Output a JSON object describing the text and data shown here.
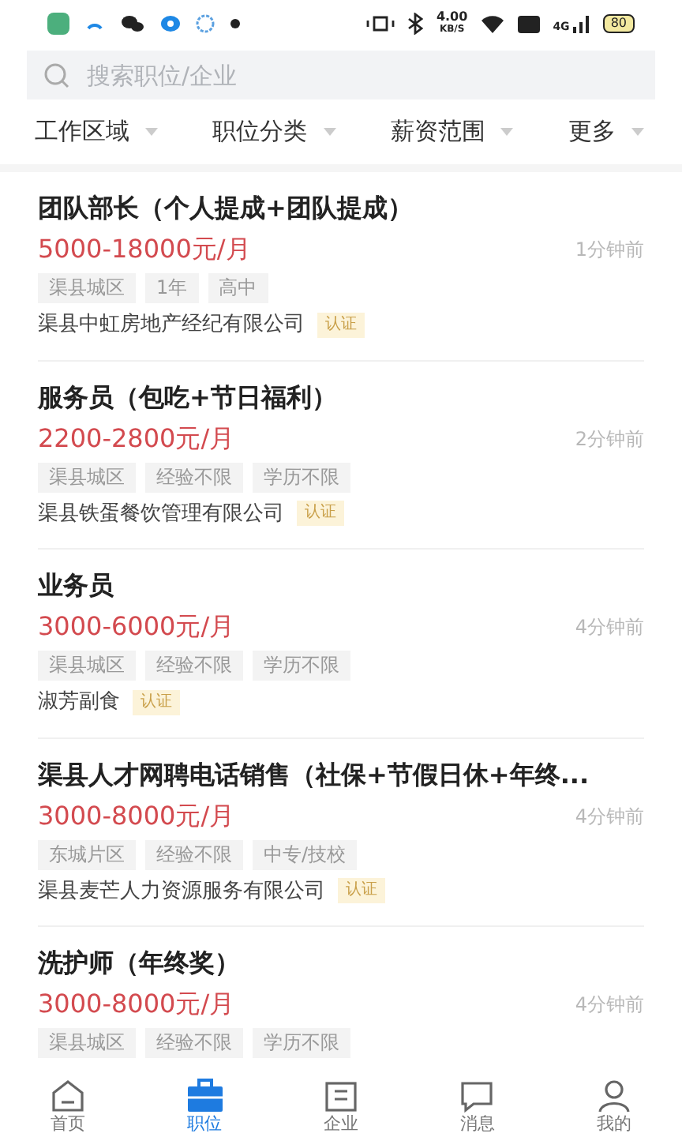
{
  "status_bar": {
    "speed": "4.00",
    "speed_unit": "KB/S",
    "network": "4G",
    "battery": "80"
  },
  "search": {
    "placeholder": "搜索职位/企业"
  },
  "filters": [
    {
      "label": "工作区域"
    },
    {
      "label": "职位分类"
    },
    {
      "label": "薪资范围"
    },
    {
      "label": "更多"
    }
  ],
  "jobs": [
    {
      "title": "团队部长（个人提成+团队提成）",
      "salary": "5000-18000元/月",
      "time": "1分钟前",
      "tags": [
        "渠县城区",
        "1年",
        "高中"
      ],
      "company": "渠县中虹房地产经纪有限公司",
      "badge": "认证"
    },
    {
      "title": "服务员（包吃+节日福利）",
      "salary": "2200-2800元/月",
      "time": "2分钟前",
      "tags": [
        "渠县城区",
        "经验不限",
        "学历不限"
      ],
      "company": "渠县铁蛋餐饮管理有限公司",
      "badge": "认证"
    },
    {
      "title": "业务员",
      "salary": "3000-6000元/月",
      "time": "4分钟前",
      "tags": [
        "渠县城区",
        "经验不限",
        "学历不限"
      ],
      "company": "淑芳副食",
      "badge": "认证"
    },
    {
      "title": "渠县人才网聘电话销售（社保+节假日休+年终...",
      "salary": "3000-8000元/月",
      "time": "4分钟前",
      "tags": [
        "东城片区",
        "经验不限",
        "中专/技校"
      ],
      "company": "渠县麦芒人力资源服务有限公司",
      "badge": "认证"
    },
    {
      "title": "洗护师（年终奖）",
      "salary": "3000-8000元/月",
      "time": "4分钟前",
      "tags": [
        "渠县城区",
        "经验不限",
        "学历不限"
      ]
    }
  ],
  "nav": [
    {
      "label": "首页",
      "kind": "home",
      "selected": false
    },
    {
      "label": "职位",
      "kind": "briefcase",
      "selected": true
    },
    {
      "label": "企业",
      "kind": "building",
      "selected": false
    },
    {
      "label": "消息",
      "kind": "message",
      "selected": false
    },
    {
      "label": "我的",
      "kind": "user",
      "selected": false
    }
  ]
}
